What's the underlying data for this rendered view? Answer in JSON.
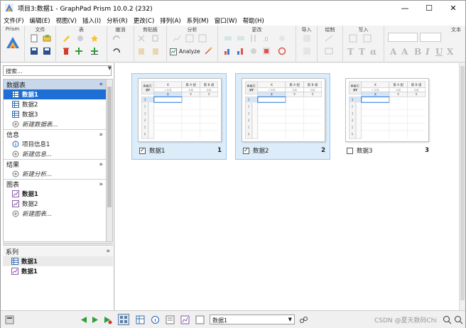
{
  "window": {
    "title": "项目3:数据1 - GraphPad Prism 10.0.2 (232)",
    "minimize": "—",
    "maximize": "☐",
    "close": "✕"
  },
  "menu": [
    "文件(F)",
    "编辑(E)",
    "视图(V)",
    "插入(I)",
    "分析(R)",
    "更改(C)",
    "排列(A)",
    "系列(M)",
    "窗口(W)",
    "帮助(H)"
  ],
  "ribbon": {
    "groups": [
      "Prism",
      "文件",
      "表",
      "撤消",
      "剪贴板",
      "分析",
      "更改",
      "导入",
      "绘制",
      "写入",
      "文本"
    ],
    "analyze_label": "Analyze"
  },
  "navigator": {
    "search_placeholder": "搜索...",
    "sections": {
      "data_tables": {
        "title": "数据表",
        "items": [
          "数据1",
          "数据2",
          "数据3"
        ],
        "new": "新建数据表..."
      },
      "info": {
        "title": "信息",
        "items": [
          "项目信息1"
        ],
        "new": "新建信息..."
      },
      "results": {
        "title": "结果",
        "new": "新建分析..."
      },
      "graphs": {
        "title": "图表",
        "items": [
          "数据1",
          "数据2"
        ],
        "new": "新建图表..."
      }
    },
    "family": {
      "title": "系列",
      "items": [
        "数据1",
        "数据1"
      ]
    }
  },
  "gallery": {
    "thumb_labels": {
      "corner": "表格式:",
      "corner2": "XY",
      "x": "X",
      "x_title": "X 标题",
      "group_a": "第 A 组",
      "group_b": "第 B 组",
      "title": "标题",
      "xcol": "X",
      "ycol": "Y",
      "rows": [
        "1",
        "2",
        "3",
        "4",
        "5",
        "6"
      ],
      "rowtitle": "标题"
    },
    "cards": [
      {
        "label": "数据1",
        "number": "1",
        "checked": true,
        "selected": true
      },
      {
        "label": "数据2",
        "number": "2",
        "checked": true,
        "selected": true
      },
      {
        "label": "数据3",
        "number": "3",
        "checked": false,
        "selected": false
      }
    ]
  },
  "statusbar": {
    "sheet_selector": "数据1",
    "watermark": "CSDN @夏天数码Chi"
  },
  "colors": {
    "accent": "#1d6fd6",
    "selected_card": "#dcecf9",
    "section_header": "#c9d7ea"
  }
}
